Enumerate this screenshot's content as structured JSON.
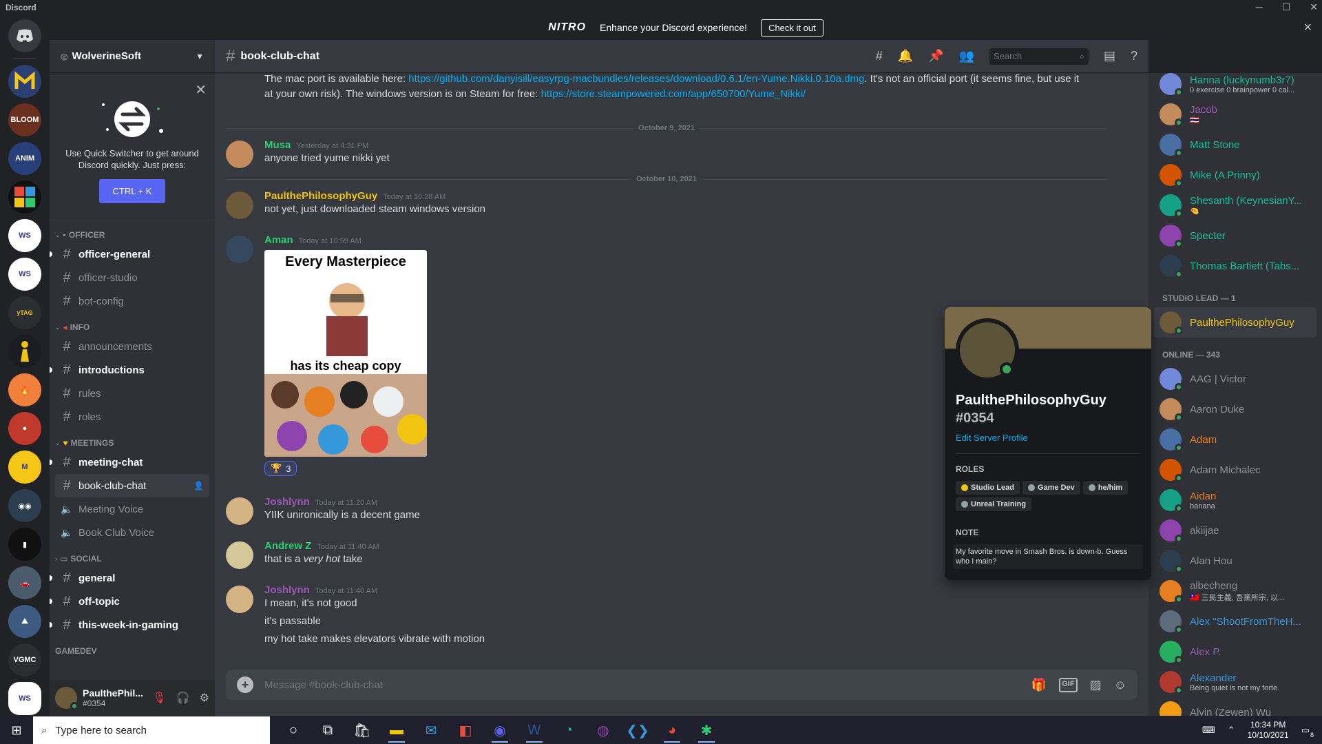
{
  "window": {
    "title": "Discord",
    "controls": [
      "─",
      "☐",
      "✕"
    ]
  },
  "banner": {
    "brand": "NITRO",
    "text": "Enhance your Discord experience!",
    "cta": "Check it out",
    "close": "✕"
  },
  "server": {
    "name": "WolverineSoft"
  },
  "switcher": {
    "text": "Use Quick Switcher to get around Discord quickly. Just press:",
    "shortcut": "CTRL + K"
  },
  "categories": {
    "officer": "OFFICER",
    "info": "INFO",
    "meetings": "MEETINGS",
    "social": "SOCIAL",
    "gamedev": "GAMEDEV"
  },
  "channels": {
    "officer_general": "officer-general",
    "officer_studio": "officer-studio",
    "bot_config": "bot-config",
    "announcements": "announcements",
    "introductions": "introductions",
    "rules": "rules",
    "roles": "roles",
    "meeting_chat": "meeting-chat",
    "book_club_chat": "book-club-chat",
    "meeting_voice": "Meeting Voice",
    "book_club_voice": "Book Club Voice",
    "general": "general",
    "off_topic": "off-topic",
    "this_week": "this-week-in-gaming"
  },
  "user": {
    "name": "PaulthePhil...",
    "tag": "#0354"
  },
  "chat": {
    "channel": "book-club-chat",
    "search_placeholder": "Search",
    "composer_placeholder": "Message #book-club-chat",
    "messages": {
      "top": {
        "pre": "The mac port is available here: ",
        "link1": "https://github.com/danyisill/easyrpg-macbundles/releases/download/0.6.1/en-Yume.Nikki.0.10a.dmg",
        "mid": ". It's not an official port (it seems fine, but use it",
        "line2": "at your own risk). The windows version is on Steam for free: ",
        "link2": "https://store.steampowered.com/app/650700/Yume_Nikki/"
      },
      "date1": "October 9, 2021",
      "musa": {
        "author": "Musa",
        "time": "Yesterday at 4:31 PM",
        "text": "anyone tried yume nikki yet"
      },
      "date2": "October 10, 2021",
      "paul": {
        "author": "PaulthePhilosophyGuy",
        "time": "Today at 10:28 AM",
        "text": "not yet, just downloaded steam windows version"
      },
      "aman": {
        "author": "Aman",
        "time": "Today at 10:59 AM",
        "meme_top": "Every Masterpiece",
        "meme_bottom": "has its cheap copy",
        "reaction_count": "3"
      },
      "josh1": {
        "author": "Joshlynn",
        "time": "Today at 11:20 AM",
        "text": "YIIK unironically is a decent game"
      },
      "andrew": {
        "author": "Andrew Z",
        "time": "Today at 11:40 AM",
        "pre": "that is a ",
        "em": "very hot",
        "post": " take"
      },
      "josh2": {
        "author": "Joshlynn",
        "time": "Today at 11:40 AM",
        "l1": "I mean, it's not good",
        "l2": "it's passable",
        "l3": "my hot take makes elevators vibrate with motion"
      }
    }
  },
  "members": {
    "top": [
      {
        "name": "Hanna (luckynumb3r7)",
        "sub": "0 exercise 0 brainpower 0 cal...",
        "color": "#1abc9c"
      },
      {
        "name": "Jacob",
        "sub": "🇹🇭",
        "color": "#9b59b6"
      },
      {
        "name": "Matt Stone",
        "sub": "",
        "color": "#1abc9c"
      },
      {
        "name": "Mike (A Prinny)",
        "sub": "",
        "color": "#1abc9c"
      },
      {
        "name": "Shesanth (KeynesianY...",
        "sub": "🤏",
        "color": "#1abc9c"
      },
      {
        "name": "Specter",
        "sub": "",
        "color": "#1abc9c"
      },
      {
        "name": "Thomas Bartlett (Tabs...",
        "sub": "",
        "color": "#1abc9c"
      }
    ],
    "studio_lead_header": "STUDIO LEAD — 1",
    "studio_lead": {
      "name": "PaulthePhilosophyGuy",
      "color": "#f1c40f"
    },
    "online_header": "ONLINE — 343",
    "online": [
      {
        "name": "AAG | Victor",
        "sub": "",
        "color": "#8e9297"
      },
      {
        "name": "Aaron Duke",
        "sub": "",
        "color": "#8e9297"
      },
      {
        "name": "Adam",
        "sub": "",
        "color": "#e67e22"
      },
      {
        "name": "Adam Michalec",
        "sub": "",
        "color": "#8e9297"
      },
      {
        "name": "Aidan",
        "sub": "banana",
        "color": "#e67e22"
      },
      {
        "name": "akiijae",
        "sub": "",
        "color": "#8e9297"
      },
      {
        "name": "Alan Hou",
        "sub": "",
        "color": "#8e9297"
      },
      {
        "name": "albecheng",
        "sub": "🇹🇼 三民主義, 吾黨所宗, 以...",
        "color": "#8e9297"
      },
      {
        "name": "Alex \"ShootFromTheH...",
        "sub": "",
        "color": "#3498db"
      },
      {
        "name": "Alex P.",
        "sub": "",
        "color": "#9b59b6"
      },
      {
        "name": "Alexander",
        "sub": "Being quiet is not my forte.",
        "color": "#3498db"
      },
      {
        "name": "Alvin (Zewen) Wu",
        "sub": "",
        "color": "#8e9297"
      }
    ]
  },
  "popout": {
    "name": "PaulthePhilosophyGuy",
    "tag": "#0354",
    "edit": "Edit Server Profile",
    "roles_label": "ROLES",
    "roles": [
      {
        "name": "Studio Lead",
        "color": "#f1c40f"
      },
      {
        "name": "Game Dev",
        "color": "#95a5a6"
      },
      {
        "name": "he/him",
        "color": "#95a5a6"
      },
      {
        "name": "Unreal Training",
        "color": "#95a5a6"
      }
    ],
    "note_label": "NOTE",
    "note": "My favorite move in Smash Bros. is down-b. Guess who I main?"
  },
  "taskbar": {
    "search": "Type here to search",
    "time": "10:34 PM",
    "date": "10/10/2021",
    "notif": "8"
  }
}
